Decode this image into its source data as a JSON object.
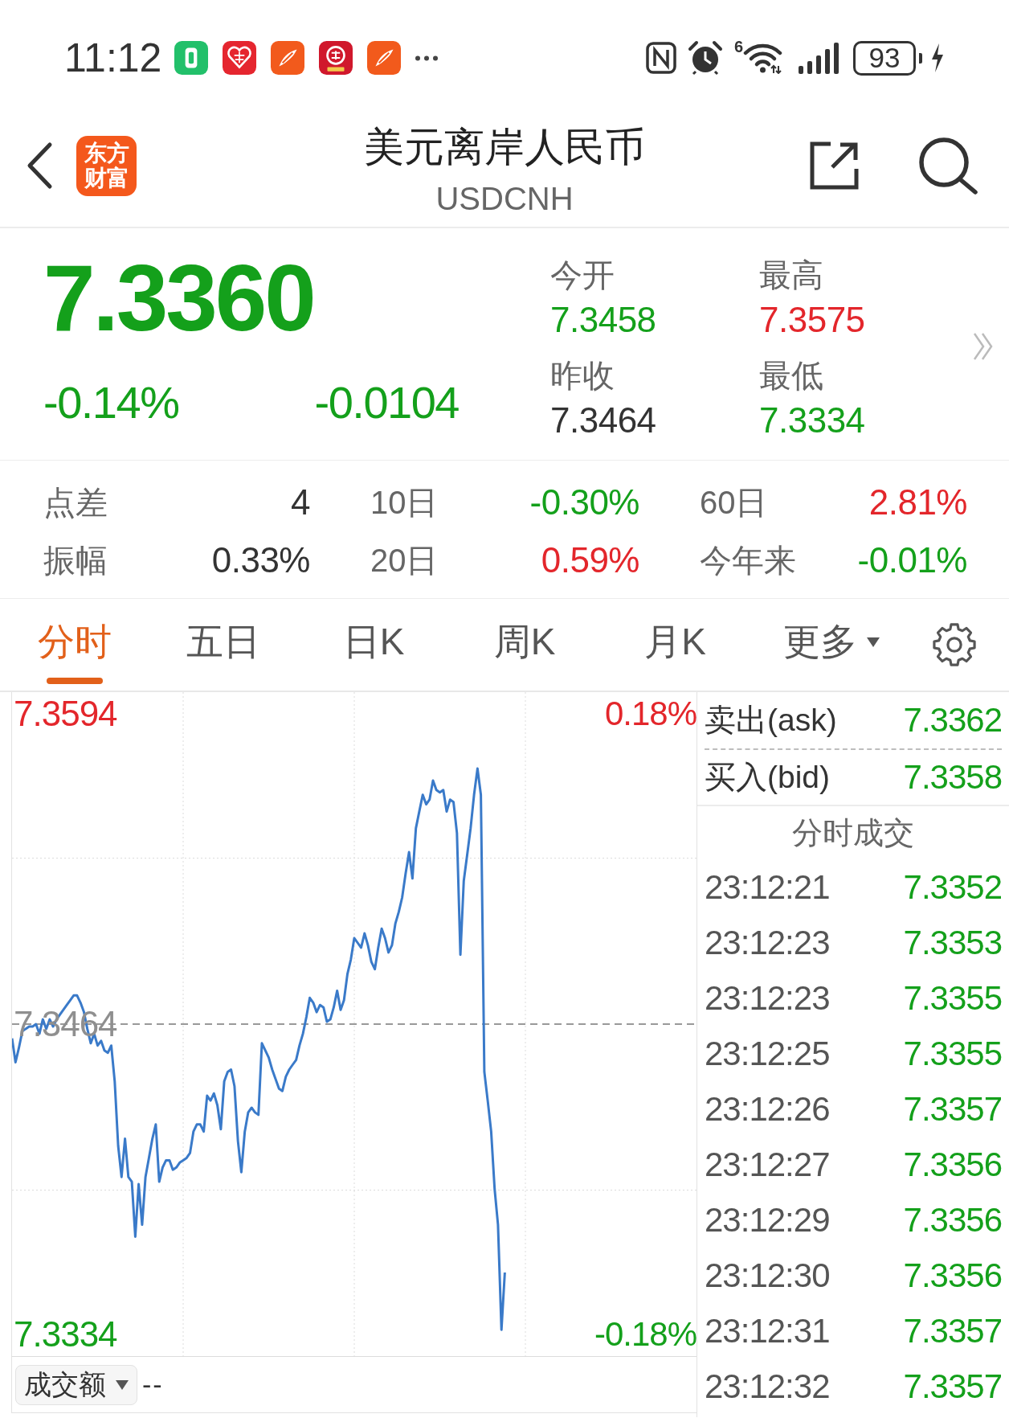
{
  "status_bar": {
    "time": "11:12",
    "wifi_badge": "6",
    "battery": "93"
  },
  "header": {
    "logo": [
      "东方",
      "财富"
    ],
    "title": "美元离岸人民币",
    "subtitle": "USDCNH"
  },
  "quote": {
    "price": {
      "text": "7.3360",
      "color": "#14a01b"
    },
    "change_pct": {
      "text": "-0.14%",
      "color": "#14a01b"
    },
    "change": {
      "text": "-0.0104",
      "color": "#14a01b"
    },
    "fields": [
      {
        "label": "今开",
        "value": "7.3458",
        "color": "#14a01b"
      },
      {
        "label": "最高",
        "value": "7.3575",
        "color": "#e3262b"
      },
      {
        "label": "昨收",
        "value": "7.3464",
        "color": "#333333"
      },
      {
        "label": "最低",
        "value": "7.3334",
        "color": "#14a01b"
      }
    ]
  },
  "stats": [
    {
      "cells": [
        {
          "label": "点差",
          "value": "4",
          "color": "#333333"
        },
        {
          "label": "10日",
          "value": "-0.30%",
          "color": "#14a01b"
        },
        {
          "label": "60日",
          "value": "2.81%",
          "color": "#e3262b"
        }
      ]
    },
    {
      "cells": [
        {
          "label": "振幅",
          "value": "0.33%",
          "color": "#333333"
        },
        {
          "label": "20日",
          "value": "0.59%",
          "color": "#e3262b"
        },
        {
          "label": "今年来",
          "value": "-0.01%",
          "color": "#14a01b"
        }
      ]
    }
  ],
  "tabs": [
    {
      "label": "分时",
      "selected": true,
      "kind": "plain"
    },
    {
      "label": "五日",
      "selected": false,
      "kind": "plain"
    },
    {
      "label": "日K",
      "selected": false,
      "kind": "plain"
    },
    {
      "label": "周K",
      "selected": false,
      "kind": "plain"
    },
    {
      "label": "月K",
      "selected": false,
      "kind": "plain"
    },
    {
      "label": "更多",
      "selected": false,
      "kind": "dropdown"
    }
  ],
  "chart": {
    "change_labels": [
      {
        "text": "0.18%",
        "color": "#e3262b"
      },
      {
        "text": "-0.18%",
        "color": "#14a01b"
      }
    ],
    "chart_data": {
      "type": "line",
      "categories": [
        null,
        null,
        null,
        null,
        null,
        null,
        null,
        null,
        null,
        null,
        null,
        null,
        null,
        null,
        null,
        null,
        null,
        null,
        null,
        null,
        null,
        null,
        null,
        null,
        null,
        null,
        null,
        null,
        null,
        null,
        null,
        null,
        null,
        null,
        null,
        null,
        null,
        null,
        null,
        null,
        null,
        null,
        null,
        null,
        null,
        null,
        null,
        null,
        null,
        null,
        null,
        null,
        null,
        null,
        null,
        null,
        null,
        null,
        null,
        null,
        null,
        null,
        null,
        null,
        null,
        null,
        null,
        null,
        null,
        null,
        null,
        null,
        null,
        null,
        null,
        null,
        null,
        null,
        null,
        null,
        null,
        null,
        null,
        null,
        null,
        null,
        null,
        null,
        null,
        null,
        null,
        null,
        null,
        null,
        null,
        null,
        null,
        null,
        null,
        null,
        null,
        null,
        null,
        null,
        null,
        null,
        null,
        null,
        null,
        null,
        null,
        null,
        null,
        null,
        null,
        null,
        null,
        null,
        null,
        null,
        null,
        null,
        null,
        null,
        null,
        null,
        null,
        null,
        null,
        null,
        null,
        null,
        null,
        null,
        null,
        null,
        null,
        null,
        null,
        null,
        null,
        null,
        null,
        null,
        null,
        null,
        null,
        null,
        null,
        null,
        null,
        null,
        null,
        null,
        null,
        null,
        null,
        null,
        null,
        null,
        null,
        null,
        null,
        null,
        null,
        null,
        null,
        null,
        null,
        null,
        null,
        null,
        null,
        null,
        null,
        null,
        null,
        null,
        null,
        null,
        null,
        null,
        null,
        null,
        null,
        null,
        null,
        null,
        null,
        null,
        null,
        null,
        null,
        null,
        null,
        null,
        null,
        null,
        null,
        null,
        null
      ],
      "ylim": [
        7.3325,
        7.3603
      ],
      "yticks": [
        {
          "value": 7.3594,
          "label": "7.3594"
        },
        {
          "value": 7.3464,
          "label": "7.3464"
        },
        {
          "value": 7.3334,
          "label": "7.3334"
        }
      ],
      "ref_lines": [
        {
          "axis": "y",
          "value": 7.3464
        }
      ],
      "series": [
        {
          "color": "#3a7ac9",
          "values": [
            7.3458,
            7.3448,
            7.3454,
            7.3461,
            7.3462,
            7.3463,
            7.3463,
            7.3464,
            7.346,
            7.3466,
            7.3462,
            7.3466,
            7.3463,
            7.3466,
            7.3468,
            7.347,
            7.3472,
            7.3474,
            7.3476,
            7.3476,
            7.3473,
            7.3469,
            7.3462,
            7.3456,
            7.346,
            7.3455,
            7.3457,
            7.3453,
            7.3452,
            7.3455,
            7.344,
            7.3413,
            7.34,
            7.3416,
            7.34,
            7.3398,
            7.3375,
            7.3397,
            7.338,
            7.34,
            7.3408,
            7.3416,
            7.3422,
            7.3398,
            7.3404,
            7.3407,
            7.3407,
            7.3403,
            7.3404,
            7.3406,
            7.3407,
            7.3408,
            7.341,
            7.3419,
            7.3422,
            7.3422,
            7.3419,
            7.3434,
            7.3432,
            7.3435,
            7.343,
            7.342,
            7.344,
            7.3444,
            7.3445,
            7.3438,
            7.3415,
            7.3402,
            7.3419,
            7.3427,
            7.3429,
            7.3427,
            7.3426,
            7.3456,
            7.3453,
            7.345,
            7.3445,
            7.3441,
            7.3437,
            7.3436,
            7.3442,
            7.3445,
            7.3447,
            7.3449,
            7.3455,
            7.346,
            7.3467,
            7.3475,
            7.3473,
            7.3469,
            7.3472,
            7.3471,
            7.3465,
            7.3466,
            7.3471,
            7.3478,
            7.347,
            7.3474,
            7.3485,
            7.3491,
            7.35,
            7.3498,
            7.3496,
            7.3502,
            7.3497,
            7.349,
            7.3487,
            7.3496,
            7.3504,
            7.35,
            7.3494,
            7.3497,
            7.3506,
            7.3511,
            7.3517,
            7.3527,
            7.3536,
            7.3525,
            7.3546,
            7.3553,
            7.356,
            7.3556,
            7.3558,
            7.3566,
            7.3562,
            7.3561,
            7.3562,
            7.3553,
            7.3558,
            7.3557,
            7.3544,
            7.3493,
            7.3524,
            7.3535,
            7.3546,
            7.356,
            7.3571,
            7.356,
            7.3444,
            7.3432,
            7.3419,
            7.3395,
            7.338,
            7.3336,
            7.336,
            null,
            null,
            null,
            null,
            null,
            null,
            null,
            null,
            null,
            null,
            null,
            null,
            null,
            null,
            null,
            null,
            null,
            null,
            null,
            null,
            null,
            null,
            null,
            null,
            null,
            null,
            null,
            null,
            null,
            null,
            null,
            null,
            null,
            null,
            null,
            null,
            null,
            null,
            null,
            null,
            null,
            null,
            null,
            null,
            null,
            null,
            null,
            null,
            null,
            null,
            null,
            null,
            null,
            null,
            null,
            null
          ]
        }
      ]
    }
  },
  "volume": {
    "label": "成交额",
    "value": "--"
  },
  "quote_panel": {
    "ask": {
      "label": "卖出(ask)",
      "value": "7.3362",
      "color": "#14a01b"
    },
    "bid": {
      "label": "买入(bid)",
      "value": "7.3358",
      "color": "#14a01b"
    },
    "trades_title": "分时成交",
    "trades": [
      {
        "time": "23:12:21",
        "price": "7.3352",
        "color": "#14a01b"
      },
      {
        "time": "23:12:23",
        "price": "7.3353",
        "color": "#14a01b"
      },
      {
        "time": "23:12:23",
        "price": "7.3355",
        "color": "#14a01b"
      },
      {
        "time": "23:12:25",
        "price": "7.3355",
        "color": "#14a01b"
      },
      {
        "time": "23:12:26",
        "price": "7.3357",
        "color": "#14a01b"
      },
      {
        "time": "23:12:27",
        "price": "7.3356",
        "color": "#14a01b"
      },
      {
        "time": "23:12:29",
        "price": "7.3356",
        "color": "#14a01b"
      },
      {
        "time": "23:12:30",
        "price": "7.3356",
        "color": "#14a01b"
      },
      {
        "time": "23:12:31",
        "price": "7.3357",
        "color": "#14a01b"
      },
      {
        "time": "23:12:32",
        "price": "7.3357",
        "color": "#14a01b"
      }
    ]
  }
}
